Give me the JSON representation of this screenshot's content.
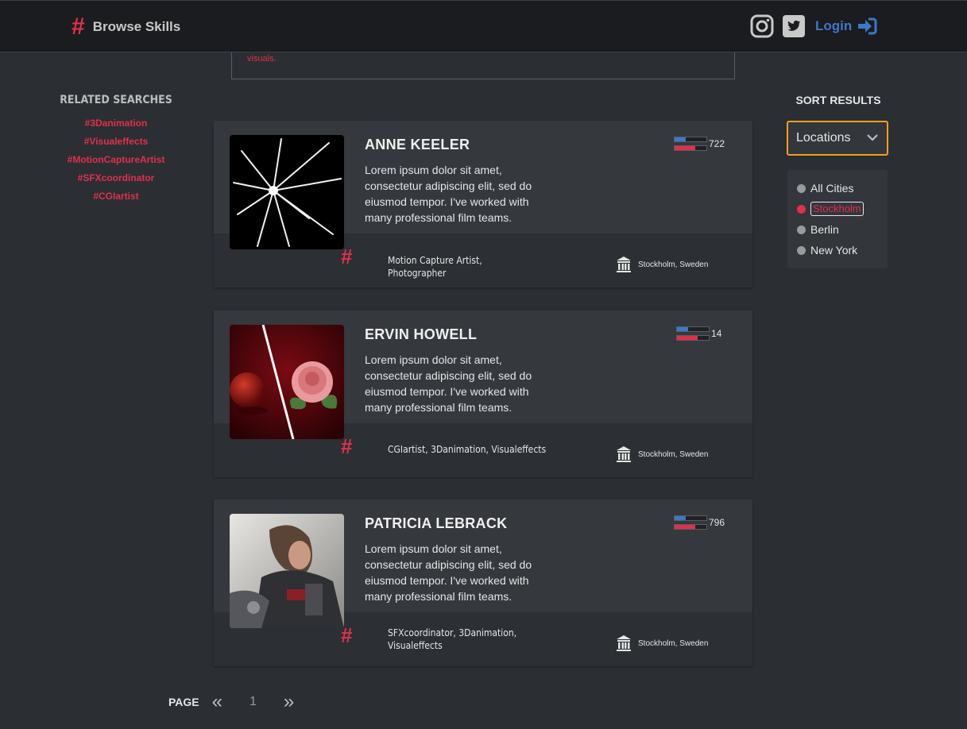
{
  "header": {
    "brand_icon": "#",
    "brand_label": "Browse Skills",
    "login_label": "Login"
  },
  "banner": {
    "text": "visuals."
  },
  "related": {
    "title": "RELATED SEARCHES",
    "tags": [
      "#3Danimation",
      "#Visualeffects",
      "#MotionCaptureArtist",
      "#SFXcoordinator",
      "#CGIartist"
    ]
  },
  "sort": {
    "title": "SORT RESULTS",
    "select_label": "Locations",
    "options": [
      "All Cities",
      "Stockholm",
      "Berlin",
      "New York"
    ],
    "selected": "Stockholm"
  },
  "cards": [
    {
      "name": "ANNE KEELER",
      "bio": "Lorem ipsum dolor sit amet, consectetur adipiscing elit, sed do eiusmod tempor. I've worked with many professional film teams.",
      "rating": "722",
      "skills": "Motion Capture Artist, Photographer",
      "location": "Stockholm, Sweden",
      "blue_fill": 0.35,
      "red_fill": 0.65
    },
    {
      "name": "ERVIN HOWELL",
      "bio": "Lorem ipsum dolor sit amet, consectetur adipiscing elit, sed do eiusmod tempor. I've worked with many professional film teams.",
      "rating": "14",
      "skills": "CGIartist, 3Danimation, Visualeffects",
      "location": "Stockholm, Sweden",
      "blue_fill": 0.35,
      "red_fill": 0.65
    },
    {
      "name": "PATRICIA LEBRACK",
      "bio": "Lorem ipsum dolor sit amet, consectetur adipiscing elit, sed do eiusmod tempor. I've worked with many professional film teams.",
      "rating": "796",
      "skills": "SFXcoordinator, 3Danimation, Visualeffects",
      "location": "Stockholm, Sweden",
      "blue_fill": 0.35,
      "red_fill": 0.65
    }
  ],
  "pager": {
    "label": "PAGE",
    "prev": "«",
    "current": "1",
    "next": "»"
  },
  "colors": {
    "accent": "#e0304b",
    "link": "#3d78c8",
    "focus": "#f0a020"
  },
  "icons": [
    "hash-icon",
    "instagram-icon",
    "twitter-icon",
    "login-icon",
    "chevron-down-icon",
    "landmark-icon"
  ]
}
